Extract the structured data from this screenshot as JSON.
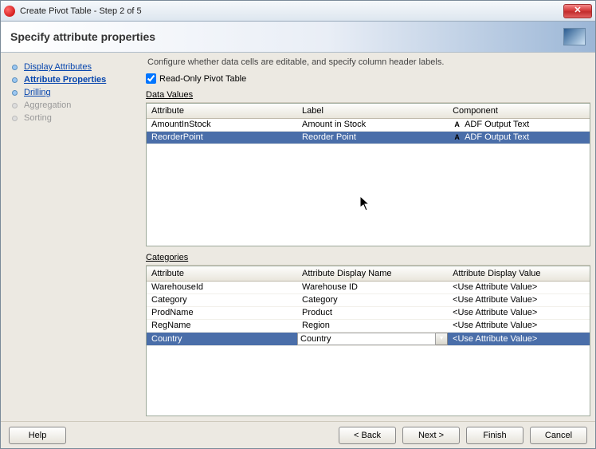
{
  "window": {
    "title": "Create Pivot Table - Step 2 of 5"
  },
  "header": {
    "step_title": "Specify attribute properties"
  },
  "nav": {
    "items": [
      {
        "label": "Display Attributes",
        "state": "link"
      },
      {
        "label": "Attribute Properties",
        "state": "active"
      },
      {
        "label": "Drilling",
        "state": "link"
      },
      {
        "label": "Aggregation",
        "state": "disabled"
      },
      {
        "label": "Sorting",
        "state": "disabled"
      }
    ]
  },
  "content": {
    "instruction": "Configure whether data cells are editable, and specify column header labels.",
    "readonly_label": "Read-Only Pivot Table",
    "readonly_checked": true,
    "data_values": {
      "section_label": "Data Values",
      "headers": {
        "attribute": "Attribute",
        "label": "Label",
        "component": "Component"
      },
      "rows": [
        {
          "attribute": "AmountInStock",
          "label": "Amount in Stock",
          "component": "ADF Output Text",
          "selected": false
        },
        {
          "attribute": "ReorderPoint",
          "label": "Reorder Point",
          "component": "ADF Output Text",
          "selected": true
        }
      ]
    },
    "categories": {
      "section_label": "Categories",
      "headers": {
        "attribute": "Attribute",
        "display_name": "Attribute Display Name",
        "display_value": "Attribute Display Value"
      },
      "rows": [
        {
          "attribute": "WarehouseId",
          "display_name": "Warehouse ID",
          "display_value": "<Use Attribute Value>",
          "selected": false
        },
        {
          "attribute": "Category",
          "display_name": "Category",
          "display_value": "<Use Attribute Value>",
          "selected": false
        },
        {
          "attribute": "ProdName",
          "display_name": "Product",
          "display_value": "<Use Attribute Value>",
          "selected": false
        },
        {
          "attribute": "RegName",
          "display_name": "Region",
          "display_value": "<Use Attribute Value>",
          "selected": false
        },
        {
          "attribute": "Country",
          "display_name": "Country",
          "display_value": "<Use Attribute Value>",
          "selected": true,
          "editing": true
        }
      ]
    }
  },
  "footer": {
    "help": "Help",
    "back": "< Back",
    "next": "Next >",
    "finish": "Finish",
    "cancel": "Cancel"
  }
}
